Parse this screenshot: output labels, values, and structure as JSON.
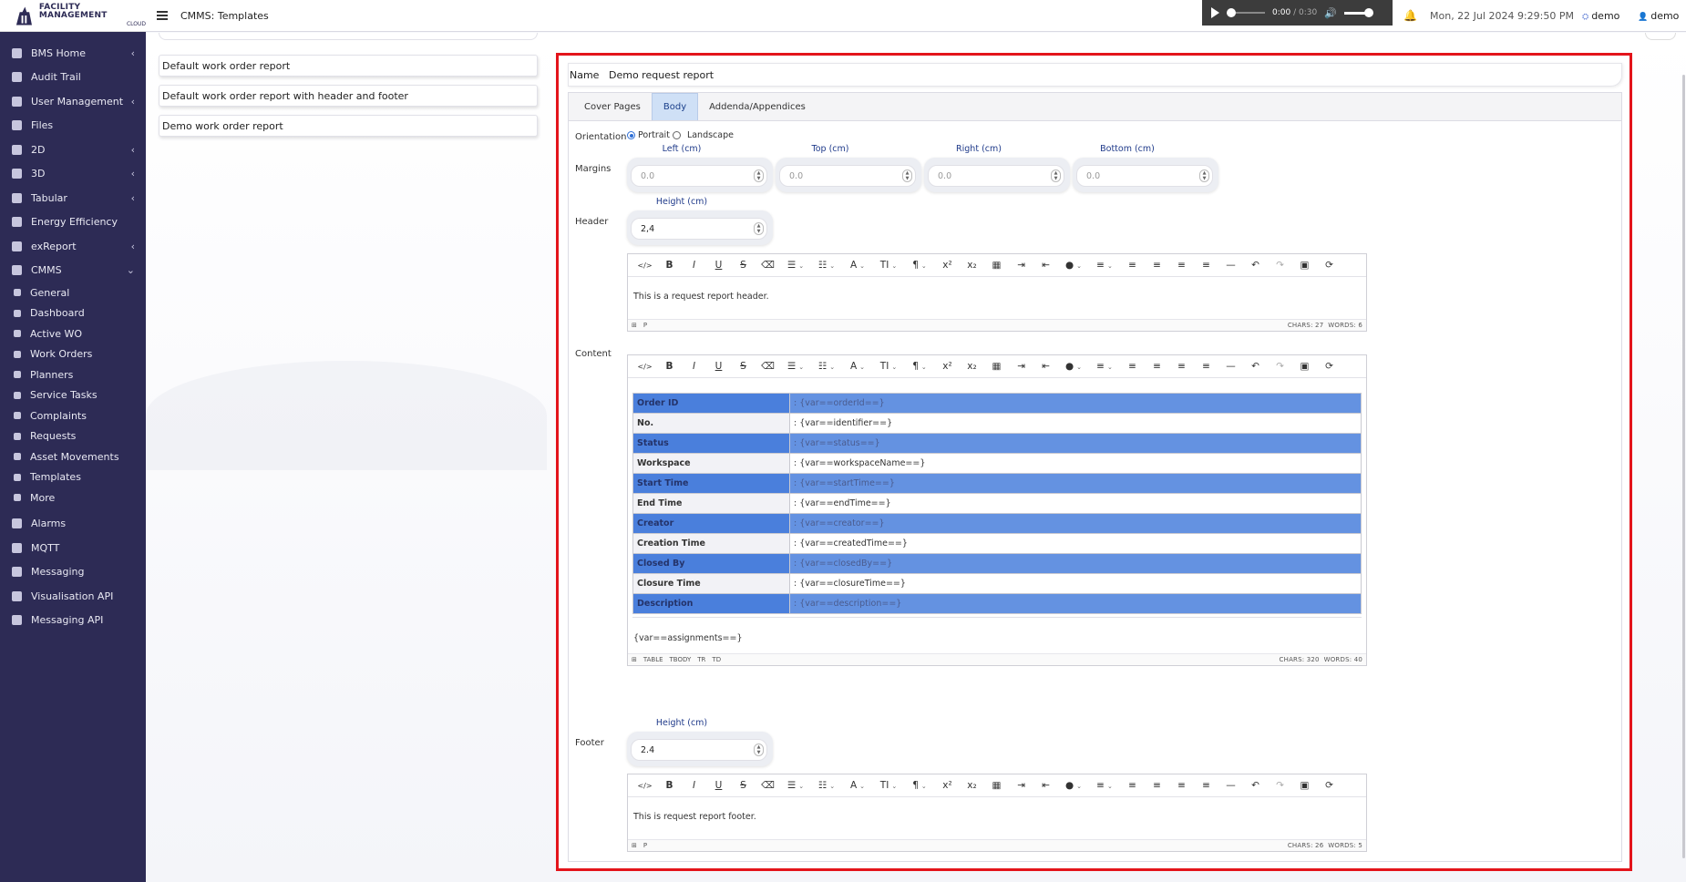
{
  "brand": {
    "name": "FACILITY MANAGEMENT",
    "sub": "CLOUD"
  },
  "topbar": {
    "title": "CMMS: Templates",
    "player": {
      "current": "0:00",
      "duration": "0:30",
      "separator": "/"
    },
    "datetime": "Mon, 22 Jul 2024 9:29:50 PM",
    "workspace": "demo",
    "user": "demo"
  },
  "sidebar": {
    "items": [
      {
        "label": "BMS Home",
        "icon": "home-icon",
        "chevron": "‹"
      },
      {
        "label": "Audit Trail",
        "icon": "audit-icon",
        "chevron": ""
      },
      {
        "label": "User Management",
        "icon": "users-icon",
        "chevron": "‹"
      },
      {
        "label": "Files",
        "icon": "files-icon",
        "chevron": ""
      },
      {
        "label": "2D",
        "icon": "layers-icon",
        "chevron": "‹"
      },
      {
        "label": "3D",
        "icon": "cube-icon",
        "chevron": "‹"
      },
      {
        "label": "Tabular",
        "icon": "table-icon",
        "chevron": "‹"
      },
      {
        "label": "Energy Efficiency",
        "icon": "energy-icon",
        "chevron": ""
      },
      {
        "label": "exReport",
        "icon": "report-icon",
        "chevron": "‹"
      },
      {
        "label": "CMMS",
        "icon": "cmms-icon",
        "chevron": "⌄"
      }
    ],
    "cmms_sub": [
      {
        "label": "General",
        "icon": "cogs-icon"
      },
      {
        "label": "Dashboard",
        "icon": "dashboard-icon"
      },
      {
        "label": "Active WO",
        "icon": "wrench-icon"
      },
      {
        "label": "Work Orders",
        "icon": "list-icon"
      },
      {
        "label": "Planners",
        "icon": "planner-icon"
      },
      {
        "label": "Service Tasks",
        "icon": "tasks-icon"
      },
      {
        "label": "Complaints",
        "icon": "complaints-icon"
      },
      {
        "label": "Requests",
        "icon": "requests-icon"
      },
      {
        "label": "Asset Movements",
        "icon": "exchange-icon"
      },
      {
        "label": "Templates",
        "icon": "template-icon"
      },
      {
        "label": "More",
        "icon": "more-icon"
      }
    ],
    "bottom_items": [
      {
        "label": "Alarms",
        "icon": "alarm-icon"
      },
      {
        "label": "MQTT",
        "icon": "mqtt-icon"
      },
      {
        "label": "Messaging",
        "icon": "messaging-icon"
      },
      {
        "label": "Visualisation API",
        "icon": "api-icon"
      },
      {
        "label": "Messaging API",
        "icon": "messaging-api-icon"
      }
    ]
  },
  "templates": [
    "Default work order report",
    "Default work order report with header and footer",
    "Demo work order report"
  ],
  "editor": {
    "name_label": "Name",
    "name_value": "Demo request report",
    "tabs": [
      "Cover Pages",
      "Body",
      "Addenda/Appendices"
    ],
    "active_tab": "Body",
    "orientation_label": "Orientation",
    "orientation_options": [
      "Portrait",
      "Landscape"
    ],
    "orientation_selected": "Portrait",
    "margins_label": "Margins",
    "margins": [
      {
        "label": "Left (cm)",
        "value": "0.0"
      },
      {
        "label": "Top (cm)",
        "value": "0.0"
      },
      {
        "label": "Right (cm)",
        "value": "0.0"
      },
      {
        "label": "Bottom (cm)",
        "value": "0.0"
      }
    ],
    "header": {
      "label": "Header",
      "height_label": "Height (cm)",
      "height_value": "2,4",
      "text": "This is a request report header.",
      "path": [
        "P"
      ],
      "chars": "CHARS: 27",
      "words": "WORDS: 6"
    },
    "content": {
      "label": "Content",
      "rows": [
        {
          "key": "Order ID",
          "value": ": {var==orderId==}",
          "highlight": true
        },
        {
          "key": "No.",
          "value": ": {var==identifier==}",
          "highlight": false
        },
        {
          "key": "Status",
          "value": ": {var==status==}",
          "highlight": true
        },
        {
          "key": "Workspace",
          "value": ": {var==workspaceName==}",
          "highlight": false
        },
        {
          "key": "Start Time",
          "value": ": {var==startTime==}",
          "highlight": true
        },
        {
          "key": "End Time",
          "value": ": {var==endTime==}",
          "highlight": false
        },
        {
          "key": "Creator",
          "value": ": {var==creator==}",
          "highlight": true
        },
        {
          "key": "Creation Time",
          "value": ": {var==createdTime==}",
          "highlight": false
        },
        {
          "key": "Closed By",
          "value": ": {var==closedBy==}",
          "highlight": true
        },
        {
          "key": "Closure Time",
          "value": ": {var==closureTime==}",
          "highlight": false
        },
        {
          "key": "Description",
          "value": ": {var==description==}",
          "highlight": true
        }
      ],
      "after_text": "{var==assignments==}",
      "path": [
        "TABLE",
        "TBODY",
        "TR",
        "TD"
      ],
      "chars": "CHARS: 320",
      "words": "WORDS: 40"
    },
    "footer": {
      "label": "Footer",
      "height_label": "Height (cm)",
      "height_value": "2.4",
      "text": "This is request report footer.",
      "path": [
        "P"
      ],
      "chars": "CHARS: 26",
      "words": "WORDS: 5"
    },
    "toolbar": [
      {
        "name": "source-code-icon",
        "glyph": "</>"
      },
      {
        "name": "bold-icon",
        "glyph": "B"
      },
      {
        "name": "italic-icon",
        "glyph": "I"
      },
      {
        "name": "underline-icon",
        "glyph": "U"
      },
      {
        "name": "strikethrough-icon",
        "glyph": "S"
      },
      {
        "name": "eraser-icon",
        "glyph": "⌫"
      },
      {
        "name": "bullet-list-icon",
        "glyph": "☰",
        "caret": true
      },
      {
        "name": "numbered-list-icon",
        "glyph": "☷",
        "caret": true
      },
      {
        "name": "font-color-icon",
        "glyph": "A",
        "caret": true
      },
      {
        "name": "font-size-icon",
        "glyph": "TI",
        "caret": true
      },
      {
        "name": "paragraph-icon",
        "glyph": "¶",
        "caret": true
      },
      {
        "name": "superscript-icon",
        "glyph": "x²"
      },
      {
        "name": "subscript-icon",
        "glyph": "x₂"
      },
      {
        "name": "table-insert-icon",
        "glyph": "▦"
      },
      {
        "name": "indent-icon",
        "glyph": "⇥"
      },
      {
        "name": "outdent-icon",
        "glyph": "⇤"
      },
      {
        "name": "fill-color-icon",
        "glyph": "●",
        "caret": true
      },
      {
        "name": "align-icon",
        "glyph": "≡",
        "caret": true
      },
      {
        "name": "align-left-icon",
        "glyph": "≡"
      },
      {
        "name": "align-center-icon",
        "glyph": "≡"
      },
      {
        "name": "align-right-icon",
        "glyph": "≡"
      },
      {
        "name": "align-justify-icon",
        "glyph": "≡"
      },
      {
        "name": "horizontal-rule-icon",
        "glyph": "—"
      },
      {
        "name": "undo-icon",
        "glyph": "↶"
      },
      {
        "name": "redo-icon",
        "glyph": "↷"
      },
      {
        "name": "image-icon",
        "glyph": "▣"
      },
      {
        "name": "fullscreen-icon",
        "glyph": "⟳"
      }
    ]
  },
  "colors": {
    "sidebar_bg": "#2d2b55",
    "highlight_row": "#4a7fdc",
    "active_tab": "#cfe0f6",
    "frame": "#e3141b",
    "label_blue": "#1f3a8a"
  }
}
